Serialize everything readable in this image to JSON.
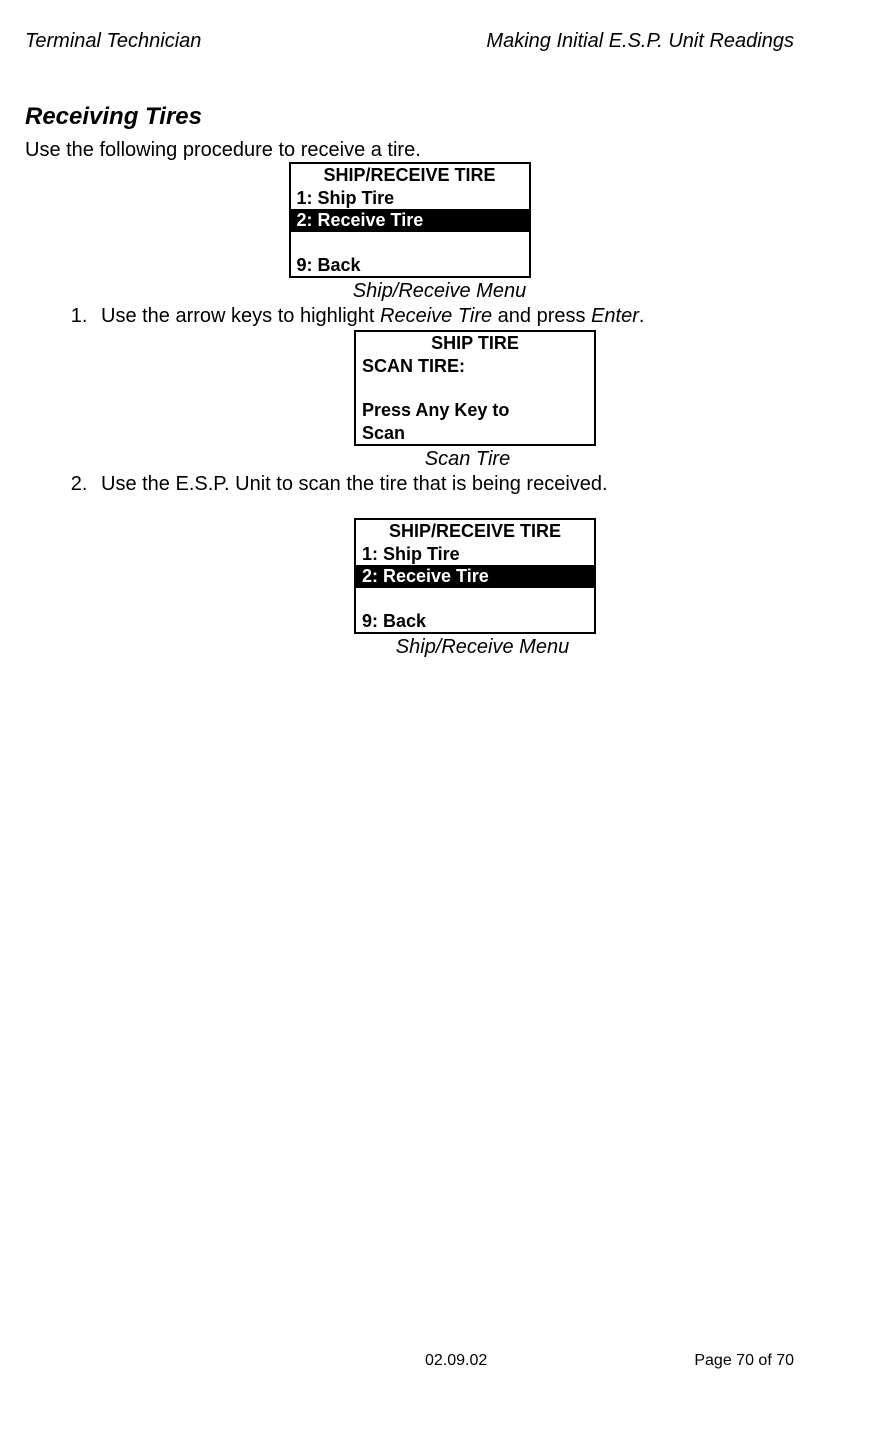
{
  "header": {
    "left": "Terminal Technician",
    "right": "Making Initial E.S.P. Unit Readings"
  },
  "section_title": "Receiving Tires",
  "intro": "Use the following procedure to receive a tire.",
  "screens": {
    "menu": {
      "title": "SHIP/RECEIVE TIRE",
      "line1": "1: Ship Tire",
      "highlight": "2: Receive Tire",
      "back": "9: Back",
      "caption": "Ship/Receive Menu"
    },
    "scan": {
      "title": "SHIP TIRE",
      "line1": "SCAN TIRE:",
      "line2": "Press Any Key to",
      "line3": "Scan",
      "caption": "Scan Tire"
    }
  },
  "steps": {
    "s1_a": "Use the arrow keys to highlight ",
    "s1_b": "Receive Tire",
    "s1_c": " and press ",
    "s1_d": "Enter",
    "s1_e": ".",
    "s2": "Use the E.S.P. Unit to scan the tire that is being received."
  },
  "footer": {
    "date": "02.09.02",
    "page": "Page 70 of 70"
  }
}
